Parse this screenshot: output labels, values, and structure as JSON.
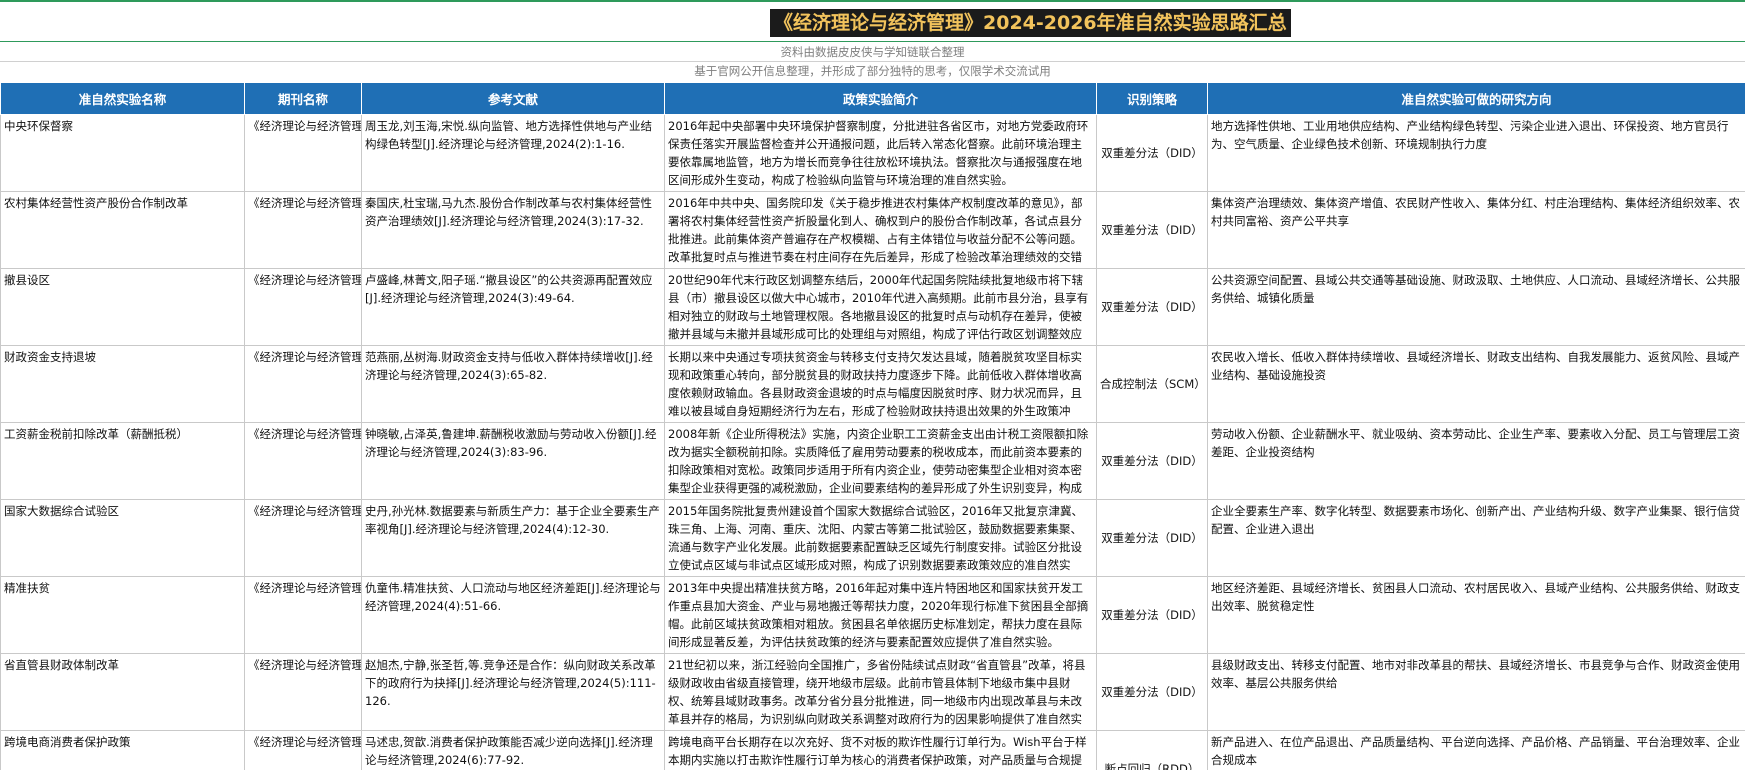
{
  "title": "《经济理论与经济管理》2024-2026年准自然实验思路汇总",
  "subtitle_source": "资料由数据皮皮侠与学知链联合整理",
  "subtitle_note": "基于官网公开信息整理，并形成了部分独特的思考，仅限学术交流试用",
  "colors": {
    "header_bg": "#1f6fb5",
    "title_bg": "#1b1b1b",
    "title_text": "#f2c35c",
    "accent_rule": "#2e9a5b"
  },
  "columns": [
    "准自然实验名称",
    "期刊名称",
    "参考文献",
    "政策实验简介",
    "识别策略",
    "准自然实验可做的研究方向"
  ],
  "rows": [
    {
      "name": "中央环保督察",
      "journal": "《经济理论与经济管理》",
      "reference": "周玉龙,刘玉海,宋悦.纵向监管、地方选择性供地与产业结构绿色转型[J].经济理论与经济管理,2024(2):1-16.",
      "intro": "2016年起中央部署中央环境保护督察制度，分批进驻各省区市，对地方党委政府环保责任落实开展监督检查并公开通报问题，此后转入常态化督察。此前环境治理主要依靠属地监管，地方为增长而竞争往往放松环境执法。督察批次与通报强度在地区间形成外生变动，构成了检验纵向监管与环境治理的准自然实验。",
      "strategy": "双重差分法（DID）",
      "directions": "地方选择性供地、工业用地供应结构、产业结构绿色转型、污染企业进入退出、环保投资、地方官员行为、空气质量、企业绿色技术创新、环境规制执行力度"
    },
    {
      "name": "农村集体经营性资产股份合作制改革",
      "journal": "《经济理论与经济管理》",
      "reference": "秦国庆,杜宝瑞,马九杰.股份合作制改革与农村集体经营性资产治理绩效[J].经济理论与经济管理,2024(3):17-32.",
      "intro": "2016年中共中央、国务院印发《关于稳步推进农村集体产权制度改革的意见》，部署将农村集体经营性资产折股量化到人、确权到户的股份合作制改革，各试点县分批推进。此前集体资产普遍存在产权模糊、占有主体错位与收益分配不公等问题。改革批复时点与推进节奏在村庄间存在先后差异，形成了检验改革治理绩效的交错政策冲击。",
      "strategy": "双重差分法（DID）",
      "directions": "集体资产治理绩效、集体资产增值、农民财产性收入、集体分红、村庄治理结构、集体经济组织效率、农村共同富裕、资产公平共享"
    },
    {
      "name": "撤县设区",
      "journal": "《经济理论与经济管理》",
      "reference": "卢盛峰,林菁文,阳子瑶.“撤县设区”的公共资源再配置效应[J].经济理论与经济管理,2024(3):49-64.",
      "intro": "20世纪90年代末行政区划调整东结后，2000年代起国务院陆续批复地级市将下辖县（市）撤县设区以做大中心城市，2010年代进入高频期。此前市县分治，县享有相对独立的财政与土地管理权限。各地撤县设区的批复时点与动机存在差异，使被撤并县域与未撤并县域形成可比的处理组与对照组，构成了评估行政区划调整效应的准自然实验。",
      "strategy": "双重差分法（DID）",
      "directions": "公共资源空间配置、县域公共交通等基础设施、财政汲取、土地供应、人口流动、县域经济增长、公共服务供给、城镇化质量"
    },
    {
      "name": "财政资金支持退坡",
      "journal": "《经济理论与经济管理》",
      "reference": "范燕丽,丛树海.财政资金支持与低收入群体持续增收[J].经济理论与经济管理,2024(3):65-82.",
      "intro": "长期以来中央通过专项扶贫资金与转移支付支持欠发达县域，随着脱贫攻坚目标实现和政策重心转向，部分脱贫县的财政扶持力度逐步下降。此前低收入群体增收高度依赖财政输血。各县财政资金退坡的时点与幅度因脱贫时序、财力状况而异，且难以被县域自身短期经济行为左右，形成了检验财政扶持退出效果的外生政策冲击。",
      "strategy": "合成控制法（SCM）",
      "directions": "农民收入增长、低收入群体持续增收、县域经济增长、财政支出结构、自我发展能力、返贫风险、县域产业结构、基础设施投资"
    },
    {
      "name": "工资薪金税前扣除改革（薪酬抵税）",
      "journal": "《经济理论与经济管理》",
      "reference": "钟晓敏,占泽英,鲁建坤.薪酬税收激励与劳动收入份额[J].经济理论与经济管理,2024(3):83-96.",
      "intro": "2008年新《企业所得税法》实施，内资企业职工工资薪金支出由计税工资限额扣除改为据实全额税前扣除。实质降低了雇用劳动要素的税收成本，而此前资本要素的扣除政策相对宽松。政策同步适用于所有内资企业，使劳动密集型企业相对资本密集型企业获得更强的减税激励，企业间要素结构的差异形成了外生识别变异，构成了准自然实验。",
      "strategy": "双重差分法（DID）",
      "directions": "劳动收入份额、企业薪酬水平、就业吸纳、资本劳动比、企业生产率、要素收入分配、员工与管理层工资差距、企业投资结构"
    },
    {
      "name": "国家大数据综合试验区",
      "journal": "《经济理论与经济管理》",
      "reference": "史丹,孙光林.数据要素与新质生产力：基于企业全要素生产率视角[J].经济理论与经济管理,2024(4):12-30.",
      "intro": "2015年国务院批复贵州建设首个国家大数据综合试验区，2016年又批复京津冀、珠三角、上海、河南、重庆、沈阳、内蒙古等第二批试验区，鼓励数据要素集聚、流通与数字产业化发展。此前数据要素配置缺乏区域先行制度安排。试验区分批设立使试点区域与非试点区域形成对照，构成了识别数据要素政策效应的准自然实验。",
      "strategy": "双重差分法（DID）",
      "directions": "企业全要素生产率、数字化转型、数据要素市场化、创新产出、产业结构升级、数字产业集聚、银行信贷配置、企业进入退出"
    },
    {
      "name": "精准扶贫",
      "journal": "《经济理论与经济管理》",
      "reference": "仇童伟.精准扶贫、人口流动与地区经济差距[J].经济理论与经济管理,2024(4):51-66.",
      "intro": "2013年中央提出精准扶贫方略，2016年起对集中连片特困地区和国家扶贫开发工作重点县加大资金、产业与易地搬迁等帮扶力度，2020年现行标准下贫困县全部摘帽。此前区域扶贫政策相对粗放。贫困县名单依据历史标准划定，帮扶力度在县际间形成显著反差，为评估扶贫政策的经济与要素配置效应提供了准自然实验。",
      "strategy": "双重差分法（DID）",
      "directions": "地区经济差距、县域经济增长、贫困县人口流动、农村居民收入、县域产业结构、公共服务供给、财政支出效率、脱贫稳定性"
    },
    {
      "name": "省直管县财政体制改革",
      "journal": "《经济理论与经济管理》",
      "reference": "赵旭杰,宁静,张圣哲,等.竞争还是合作：纵向财政关系改革下的政府行为抉择[J].经济理论与经济管理,2024(5):111-126.",
      "intro": "21世纪初以来，浙江经验向全国推广，多省份陆续试点财政“省直管县”改革，将县级财政收由省级直接管理，绕开地级市层级。此前市管县体制下地级市集中县财权、统筹县域财政事务。改革分省分县分批推进，同一地级市内出现改革县与未改革县并存的格局，为识别纵向财政关系调整对政府行为的因果影响提供了准自然实验。",
      "strategy": "双重差分法（DID）",
      "directions": "县级财政支出、转移支付配置、地市对非改革县的帮扶、县域经济增长、市县竞争与合作、财政资金使用效率、基层公共服务供给"
    },
    {
      "name": "跨境电商消费者保护政策",
      "journal": "《经济理论与经济管理》",
      "reference": "马述忠,贺歆.消费者保护政策能否减少逆向选择[J].经济理论与经济管理,2024(6):77-92.",
      "intro": "跨境电商平台长期存在以次充好、货不对板的欺诈性履行订单行为。Wish平台于样本期内实施以打击欺诈性履行订单为核心的消费者保护政策，对产品质量与合规提出更高要求并配套处罚机制。政策在特定时点统一生效，根据平台内企业违规与一次性处罚规制的影响差异，构成了识别消费者保护政策逆向选择效应的断点设计。",
      "strategy": "断点回归（RDD）",
      "directions": "新产品进入、在位产品退出、产品质量结构、平台逆向选择、产品价格、产品销量、平台治理效率、企业合规成本"
    }
  ]
}
